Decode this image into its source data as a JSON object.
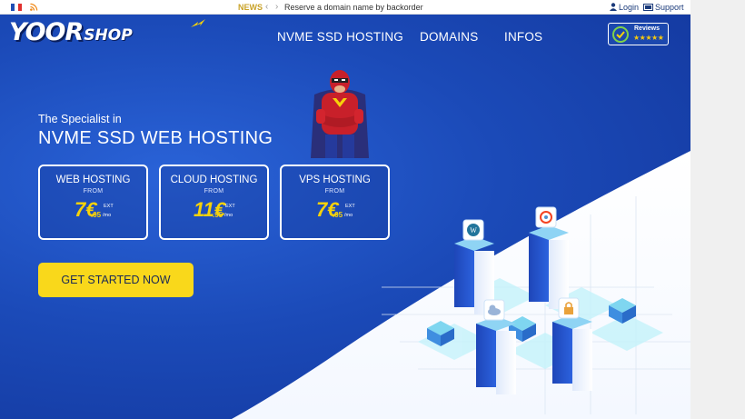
{
  "topbar": {
    "news_label": "NEWS",
    "news_prev": "‹",
    "news_next": "›",
    "news_text": "Reserve a domain name by backorder",
    "login": "Login",
    "support": "Support"
  },
  "brand": {
    "logo_main": "YOOR",
    "logo_suffix": "SHOP"
  },
  "nav": {
    "items": [
      "NVME SSD HOSTING",
      "DOMAINS",
      "INFOS"
    ]
  },
  "reviews": {
    "label": "Reviews",
    "stars": "★★★★★"
  },
  "hero": {
    "kicker": "The Specialist in",
    "headline": "NVME SSD WEB HOSTING"
  },
  "plans": [
    {
      "title": "WEB HOSTING",
      "from": "FROM",
      "price_int": "7€",
      "price_cents": ".95",
      "ext": "EXT",
      "period": "/mo"
    },
    {
      "title": "CLOUD HOSTING",
      "from": "FROM",
      "price_int": "11€",
      "price_cents": ".95",
      "ext": "EXT",
      "period": "/mo"
    },
    {
      "title": "VPS HOSTING",
      "from": "FROM",
      "price_int": "7€",
      "price_cents": ".95",
      "ext": "EXT",
      "period": "/mo"
    }
  ],
  "cta": {
    "label": "GET STARTED NOW"
  },
  "colors": {
    "hero_blue": "#1b4ab8",
    "accent_yellow": "#f9d81b",
    "news_gold": "#c9a227",
    "server_cyan": "#7fe0f2"
  },
  "icons": [
    "france-flag-icon",
    "rss-icon",
    "user-icon",
    "support-icon",
    "reviews-check-icon",
    "hero-mascot",
    "server-illustration",
    "wordpress-icon",
    "joomla-icon",
    "lock-icon",
    "cloud-icon"
  ]
}
